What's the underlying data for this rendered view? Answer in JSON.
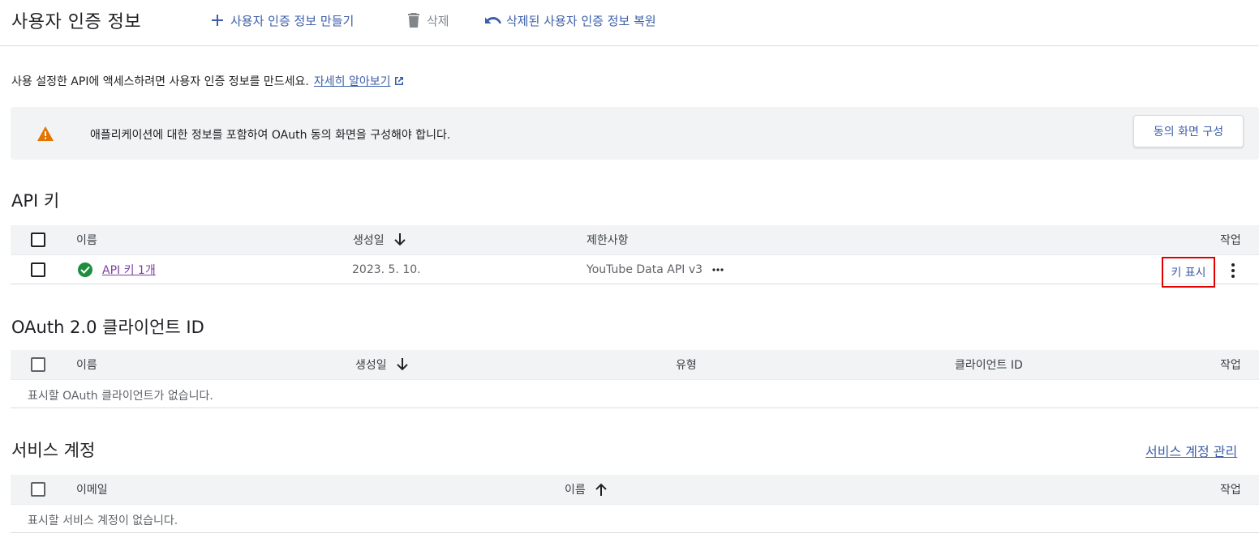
{
  "header": {
    "title": "사용자 인증 정보",
    "create_label": "사용자 인증 정보 만들기",
    "delete_label": "삭제",
    "restore_label": "삭제된 사용자 인증 정보 복원"
  },
  "intro": {
    "text": "사용 설정한 API에 액세스하려면 사용자 인증 정보를 만드세요.",
    "link": "자세히 알아보기"
  },
  "banner": {
    "message": "애플리케이션에 대한 정보를 포함하여 OAuth 동의 화면을 구성해야 합니다.",
    "button": "동의 화면 구성"
  },
  "api_keys": {
    "title": "API 키",
    "columns": {
      "name": "이름",
      "created": "생성일",
      "restrictions": "제한사항",
      "actions": "작업"
    },
    "rows": [
      {
        "name": "API 키 1개",
        "created": "2023. 5. 10.",
        "restrictions": "YouTube Data API v3",
        "show_key": "키 표시"
      }
    ]
  },
  "oauth": {
    "title": "OAuth 2.0 클라이언트 ID",
    "columns": {
      "name": "이름",
      "created": "생성일",
      "type": "유형",
      "client_id": "클라이언트 ID",
      "actions": "작업"
    },
    "empty": "표시할 OAuth 클라이언트가 없습니다."
  },
  "service_accounts": {
    "title": "서비스 계정",
    "manage_link": "서비스 계정 관리",
    "columns": {
      "email": "이메일",
      "name": "이름",
      "actions": "작업"
    },
    "empty": "표시할 서비스 계정이 없습니다."
  },
  "colors": {
    "link": "#3c5ea8",
    "visited": "#7b3fa0",
    "ok": "#1e8e3e",
    "warn": "#e37400",
    "highlight": "#e00000"
  }
}
